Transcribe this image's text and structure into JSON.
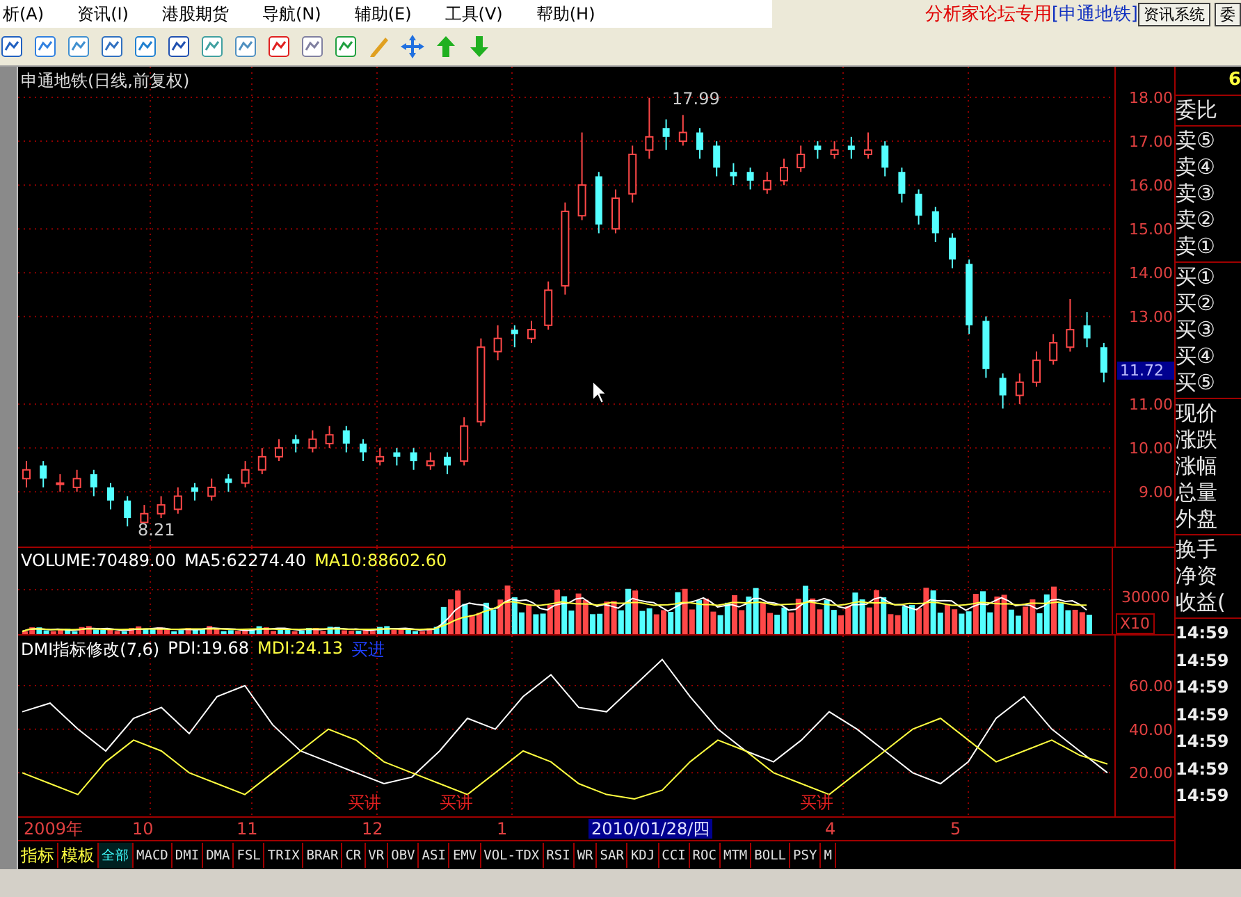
{
  "menu": {
    "items": [
      "析(A)",
      "资讯(I)",
      "港股期货",
      "导航(N)",
      "辅助(E)",
      "工具(V)",
      "帮助(H)"
    ],
    "forum_label": "分析家论坛专用",
    "stock_label": "[申通地铁]",
    "buttons": [
      "资讯系统",
      "委"
    ]
  },
  "main_chart": {
    "title": "申通地铁(日线,前复权)",
    "high_label": "17.99",
    "low_label": "8.21",
    "current_price": "11.72",
    "chart_data": {
      "type": "candlestick",
      "grid": true,
      "ylim": [
        7.75,
        18.7
      ],
      "yticks": [
        {
          "value": 18,
          "label": "18.00"
        },
        {
          "value": 17,
          "label": "17.00"
        },
        {
          "value": 16,
          "label": "16.00"
        },
        {
          "value": 15,
          "label": "15.00"
        },
        {
          "value": 14,
          "label": "14.00"
        },
        {
          "value": 13,
          "label": "13.00"
        },
        {
          "value": 11,
          "label": "11.00"
        },
        {
          "value": 10,
          "label": "10.00"
        },
        {
          "value": 9,
          "label": "9.00"
        }
      ],
      "ohlc": [
        [
          9.3,
          9.7,
          9.1,
          9.5
        ],
        [
          9.6,
          9.7,
          9.1,
          9.3
        ],
        [
          9.2,
          9.4,
          9.0,
          9.2
        ],
        [
          9.1,
          9.5,
          9.0,
          9.3
        ],
        [
          9.4,
          9.5,
          8.9,
          9.1
        ],
        [
          9.1,
          9.2,
          8.6,
          8.8
        ],
        [
          8.8,
          8.9,
          8.21,
          8.4
        ],
        [
          8.3,
          8.7,
          8.3,
          8.5
        ],
        [
          8.5,
          8.9,
          8.4,
          8.7
        ],
        [
          8.6,
          9.1,
          8.5,
          8.9
        ],
        [
          9.1,
          9.2,
          8.8,
          9.0
        ],
        [
          8.9,
          9.3,
          8.8,
          9.1
        ],
        [
          9.3,
          9.4,
          9.0,
          9.2
        ],
        [
          9.2,
          9.7,
          9.1,
          9.5
        ],
        [
          9.5,
          10.0,
          9.4,
          9.8
        ],
        [
          9.8,
          10.2,
          9.7,
          10.0
        ],
        [
          10.2,
          10.3,
          9.9,
          10.1
        ],
        [
          10.0,
          10.4,
          9.9,
          10.2
        ],
        [
          10.1,
          10.5,
          10.0,
          10.3
        ],
        [
          10.4,
          10.5,
          9.9,
          10.1
        ],
        [
          10.1,
          10.2,
          9.7,
          9.9
        ],
        [
          9.7,
          10.0,
          9.6,
          9.8
        ],
        [
          9.9,
          10.0,
          9.6,
          9.8
        ],
        [
          9.9,
          10.0,
          9.5,
          9.7
        ],
        [
          9.6,
          9.9,
          9.5,
          9.7
        ],
        [
          9.8,
          9.9,
          9.4,
          9.6
        ],
        [
          9.7,
          10.7,
          9.6,
          10.5
        ],
        [
          10.6,
          12.5,
          10.5,
          12.3
        ],
        [
          12.2,
          12.8,
          12.0,
          12.5
        ],
        [
          12.7,
          12.8,
          12.3,
          12.6
        ],
        [
          12.5,
          12.9,
          12.4,
          12.7
        ],
        [
          12.8,
          13.8,
          12.7,
          13.6
        ],
        [
          13.7,
          15.6,
          13.5,
          15.4
        ],
        [
          15.3,
          17.2,
          15.2,
          16.0
        ],
        [
          16.2,
          16.3,
          14.9,
          15.1
        ],
        [
          15.0,
          15.9,
          14.9,
          15.7
        ],
        [
          15.8,
          16.9,
          15.6,
          16.7
        ],
        [
          16.8,
          17.99,
          16.6,
          17.1
        ],
        [
          17.3,
          17.5,
          16.8,
          17.1
        ],
        [
          17.0,
          17.6,
          16.9,
          17.2
        ],
        [
          17.2,
          17.3,
          16.6,
          16.8
        ],
        [
          16.9,
          17.0,
          16.2,
          16.4
        ],
        [
          16.3,
          16.5,
          16.0,
          16.2
        ],
        [
          16.3,
          16.4,
          15.9,
          16.1
        ],
        [
          15.9,
          16.3,
          15.8,
          16.1
        ],
        [
          16.1,
          16.6,
          16.0,
          16.4
        ],
        [
          16.4,
          16.9,
          16.3,
          16.7
        ],
        [
          16.9,
          17.0,
          16.6,
          16.8
        ],
        [
          16.7,
          17.0,
          16.6,
          16.8
        ],
        [
          16.9,
          17.1,
          16.6,
          16.8
        ],
        [
          16.7,
          17.2,
          16.6,
          16.8
        ],
        [
          16.9,
          17.0,
          16.2,
          16.4
        ],
        [
          16.3,
          16.4,
          15.6,
          15.8
        ],
        [
          15.8,
          15.9,
          15.1,
          15.3
        ],
        [
          15.4,
          15.5,
          14.7,
          14.9
        ],
        [
          14.8,
          14.9,
          14.1,
          14.3
        ],
        [
          14.2,
          14.3,
          12.6,
          12.8
        ],
        [
          12.9,
          13.0,
          11.6,
          11.8
        ],
        [
          11.6,
          11.7,
          10.9,
          11.2
        ],
        [
          11.2,
          11.7,
          11.0,
          11.5
        ],
        [
          11.5,
          12.2,
          11.4,
          12.0
        ],
        [
          12.0,
          12.6,
          11.9,
          12.4
        ],
        [
          12.3,
          13.4,
          12.2,
          12.7
        ],
        [
          12.8,
          13.1,
          12.3,
          12.5
        ],
        [
          12.3,
          12.4,
          11.5,
          11.72
        ]
      ]
    }
  },
  "volume": {
    "items": [
      {
        "text": "VOLUME:70489.00",
        "color": "#ffffff"
      },
      {
        "text": "MA5:62274.40",
        "color": "#ffffff"
      },
      {
        "text": "MA10:88602.60",
        "color": "#ffff40"
      }
    ],
    "ticks": [
      "30000"
    ],
    "scale": "X10"
  },
  "dmi": {
    "items": [
      {
        "text": "DMI指标修改(7,6)",
        "color": "#ffffff"
      },
      {
        "text": "PDI:19.68",
        "color": "#ffffff"
      },
      {
        "text": "MDI:24.13",
        "color": "#ffff40"
      },
      {
        "text": "买进",
        "color": "#2040ff"
      }
    ],
    "signals": [
      "买讲",
      "买讲",
      "买讲"
    ],
    "chart_data": {
      "type": "line",
      "grid": true,
      "ylim": [
        0,
        83
      ],
      "yticks": [
        {
          "value": 60,
          "label": "60.00"
        },
        {
          "value": 40,
          "label": "40.00"
        },
        {
          "value": 20,
          "label": "20.00"
        }
      ],
      "series": [
        {
          "color": "#ffffff",
          "values": [
            48,
            52,
            40,
            30,
            45,
            50,
            38,
            55,
            60,
            42,
            30,
            25,
            20,
            15,
            18,
            30,
            45,
            40,
            55,
            65,
            50,
            48,
            60,
            72,
            55,
            40,
            30,
            25,
            35,
            48,
            40,
            30,
            20,
            15,
            25,
            45,
            55,
            40,
            30,
            20
          ]
        },
        {
          "color": "#ffff40",
          "values": [
            20,
            15,
            10,
            25,
            35,
            30,
            20,
            15,
            10,
            20,
            30,
            40,
            35,
            25,
            20,
            15,
            10,
            20,
            30,
            25,
            15,
            10,
            8,
            12,
            25,
            35,
            30,
            20,
            15,
            10,
            20,
            30,
            40,
            45,
            35,
            25,
            30,
            35,
            28,
            24
          ]
        }
      ]
    }
  },
  "date_axis": [
    {
      "text": "2009年",
      "selected": false
    },
    {
      "text": "10",
      "selected": false
    },
    {
      "text": "11",
      "selected": false
    },
    {
      "text": "12",
      "selected": false
    },
    {
      "text": "1",
      "selected": false
    },
    {
      "text": "2010/01/28/四",
      "selected": true
    },
    {
      "text": "4",
      "selected": false
    },
    {
      "text": "5",
      "selected": false
    }
  ],
  "tabs": [
    {
      "label": "指标",
      "kind": "label",
      "selected": false
    },
    {
      "label": "模板",
      "kind": "label",
      "selected": false
    },
    {
      "label": "全部",
      "kind": "tab",
      "selected": true
    },
    {
      "label": "MACD",
      "kind": "tab",
      "selected": false
    },
    {
      "label": "DMI",
      "kind": "tab",
      "selected": false
    },
    {
      "label": "DMA",
      "kind": "tab",
      "selected": false
    },
    {
      "label": "FSL",
      "kind": "tab",
      "selected": false
    },
    {
      "label": "TRIX",
      "kind": "tab",
      "selected": false
    },
    {
      "label": "BRAR",
      "kind": "tab",
      "selected": false
    },
    {
      "label": "CR",
      "kind": "tab",
      "selected": false
    },
    {
      "label": "VR",
      "kind": "tab",
      "selected": false
    },
    {
      "label": "OBV",
      "kind": "tab",
      "selected": false
    },
    {
      "label": "ASI",
      "kind": "tab",
      "selected": false
    },
    {
      "label": "EMV",
      "kind": "tab",
      "selected": false
    },
    {
      "label": "VOL-TDX",
      "kind": "tab",
      "selected": false
    },
    {
      "label": "RSI",
      "kind": "tab",
      "selected": false
    },
    {
      "label": "WR",
      "kind": "tab",
      "selected": false
    },
    {
      "label": "SAR",
      "kind": "tab",
      "selected": false
    },
    {
      "label": "KDJ",
      "kind": "tab",
      "selected": false
    },
    {
      "label": "CCI",
      "kind": "tab",
      "selected": false
    },
    {
      "label": "ROC",
      "kind": "tab",
      "selected": false
    },
    {
      "label": "MTM",
      "kind": "tab",
      "selected": false
    },
    {
      "label": "BOLL",
      "kind": "tab",
      "selected": false
    },
    {
      "label": "PSY",
      "kind": "tab",
      "selected": false
    },
    {
      "label": "M",
      "kind": "tab",
      "selected": false
    }
  ],
  "quote_panel": {
    "top_value": "6",
    "groups": [
      [
        "委比"
      ],
      [
        "卖⑤",
        "卖④",
        "卖③",
        "卖②",
        "卖①"
      ],
      [
        "买①",
        "买②",
        "买③",
        "买④",
        "买⑤"
      ],
      [
        "现价",
        "涨跌",
        "涨幅",
        "总量",
        "外盘"
      ],
      [
        "换手",
        "净资",
        "收益("
      ]
    ],
    "times": [
      "14:59",
      "14:59",
      "14:59",
      "14:59",
      "14:59",
      "14:59",
      "14:59"
    ]
  }
}
